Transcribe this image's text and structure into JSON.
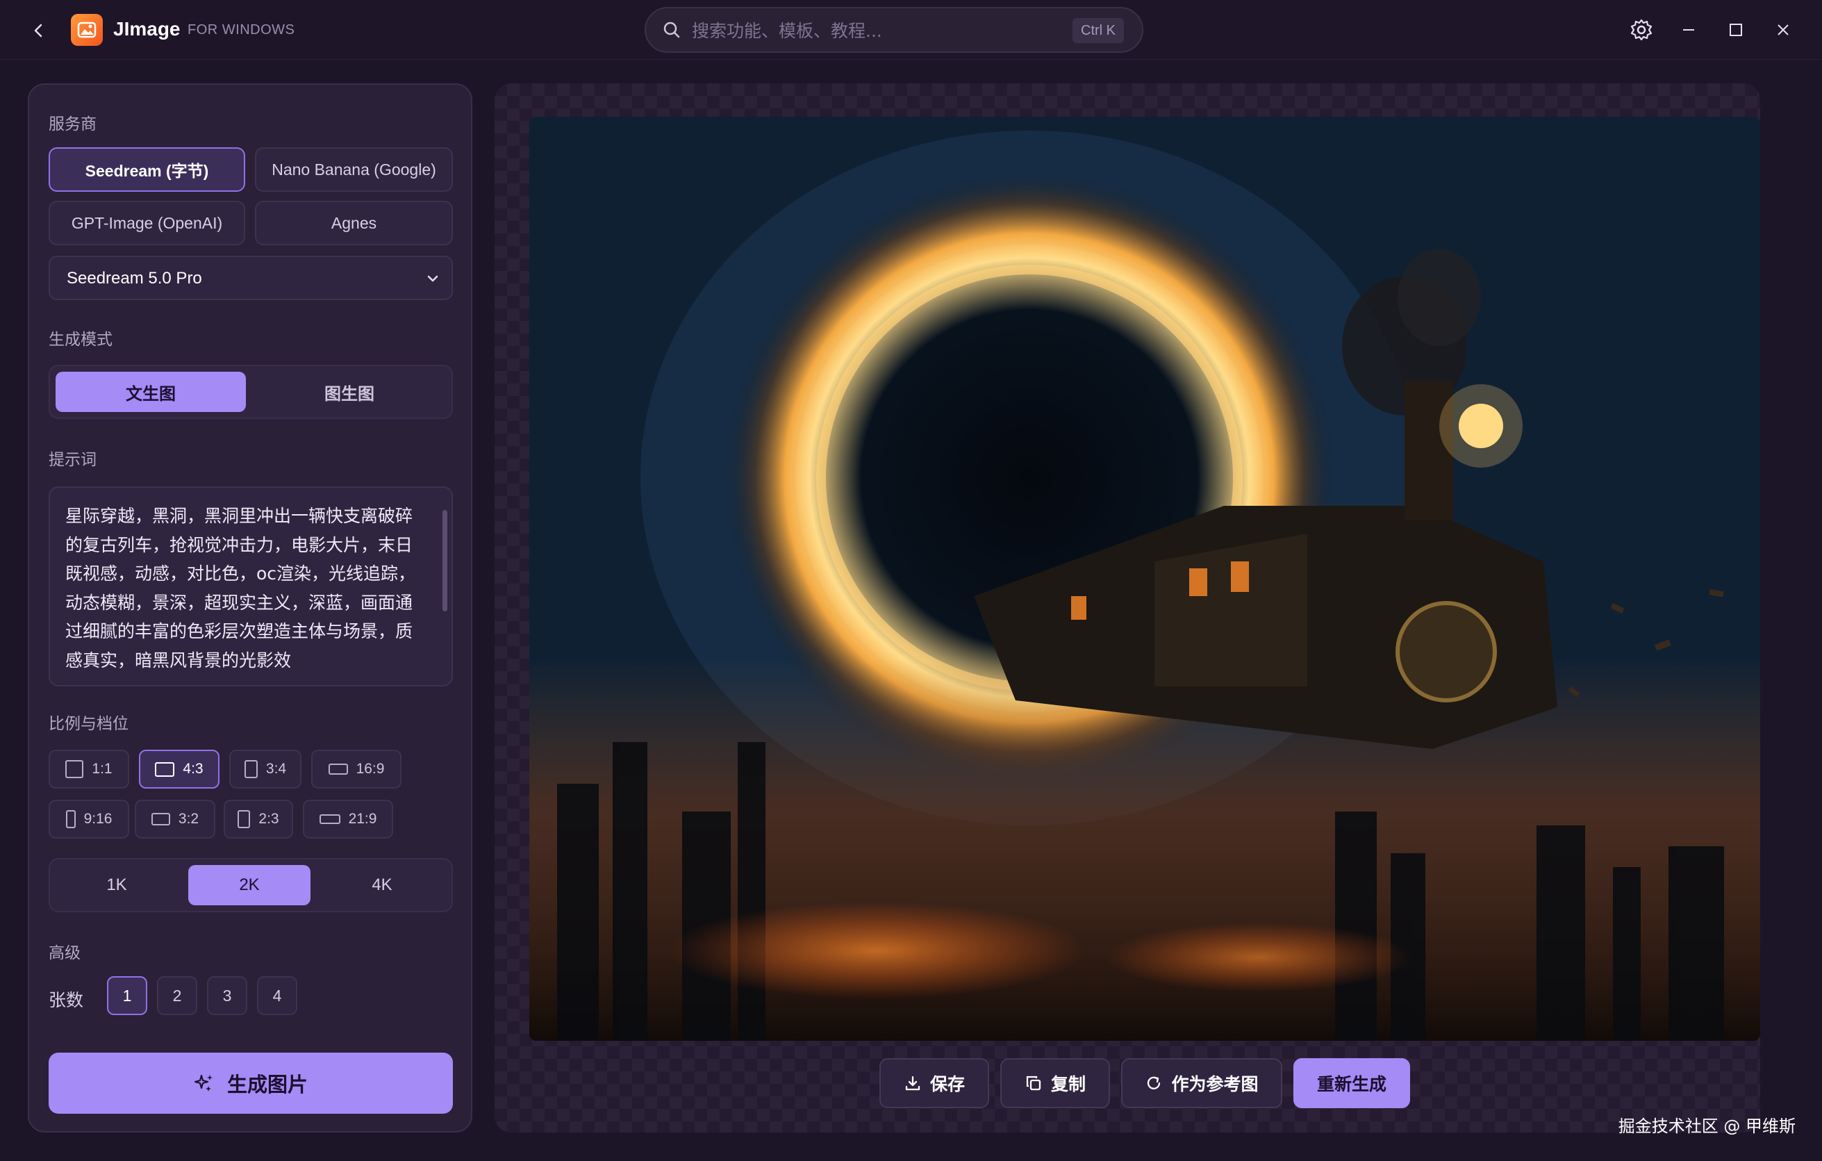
{
  "titlebar": {
    "app_name": "JImage",
    "platform": "FOR WINDOWS",
    "search_placeholder": "搜索功能、模板、教程...",
    "search_shortcut": "Ctrl K"
  },
  "sidebar": {
    "provider_label": "服务商",
    "providers": [
      "Seedream (字节)",
      "Nano Banana (Google)",
      "GPT-Image (OpenAI)",
      "Agnes"
    ],
    "selected_provider": "Seedream (字节)",
    "model_value": "Seedream 5.0 Pro",
    "mode_label": "生成模式",
    "modes": [
      "文生图",
      "图生图"
    ],
    "selected_mode": "文生图",
    "prompt_label": "提示词",
    "prompt_text": "星际穿越，黑洞，黑洞里冲出一辆快支离破碎的复古列车，抢视觉冲击力，电影大片，末日既视感，动感，对比色，oc渲染，光线追踪，动态模糊，景深，超现实主义，深蓝，画面通过细腻的丰富的色彩层次塑造主体与场景，质感真实，暗黑风背景的光影效",
    "ratio_label": "比例与档位",
    "ratios": [
      "1:1",
      "4:3",
      "3:4",
      "16:9",
      "9:16",
      "3:2",
      "2:3",
      "21:9"
    ],
    "selected_ratio": "4:3",
    "resolutions": [
      "1K",
      "2K",
      "4K"
    ],
    "selected_resolution": "2K",
    "advanced_label": "高级",
    "count_label": "张数",
    "counts": [
      "1",
      "2",
      "3",
      "4"
    ],
    "selected_count": "1",
    "generate_label": "生成图片"
  },
  "actions": {
    "save": "保存",
    "copy": "复制",
    "use_as_reference": "作为参考图",
    "regenerate": "重新生成"
  },
  "watermark": "掘金技术社区 @ 甲维斯",
  "colors": {
    "accent": "#a58bf5",
    "active_border": "#8f72e8",
    "background": "#1c1528",
    "panel": "#2a2037"
  },
  "icons": [
    "back-icon",
    "app-logo-icon",
    "search-icon",
    "gear-icon",
    "minimize-icon",
    "maximize-icon",
    "close-icon",
    "chevron-down-icon",
    "sparkle-icon",
    "download-icon",
    "copy-icon",
    "refresh-icon"
  ]
}
